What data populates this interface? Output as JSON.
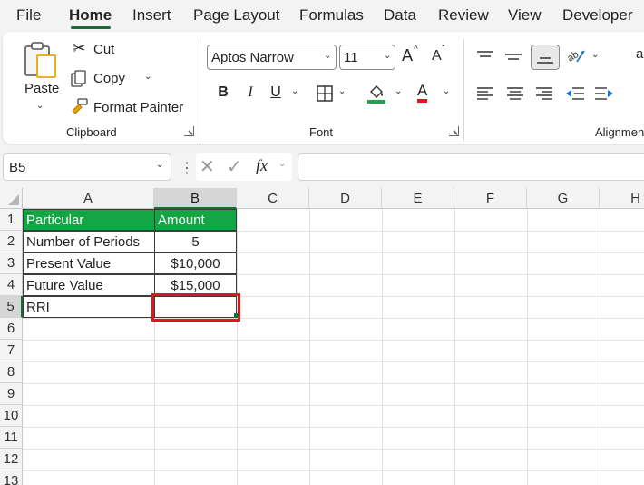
{
  "menu_tabs": [
    "File",
    "Home",
    "Insert",
    "Page Layout",
    "Formulas",
    "Data",
    "Review",
    "View",
    "Developer"
  ],
  "active_tab": "Home",
  "clipboard": {
    "paste": "Paste",
    "cut": "Cut",
    "copy": "Copy",
    "format_painter": "Format Painter",
    "group_label": "Clipboard"
  },
  "font": {
    "font_name": "Aptos Narrow",
    "font_size": "11",
    "group_label": "Font",
    "bold": "B",
    "italic": "I",
    "underline": "U",
    "font_color_letter": "A",
    "grow": "A",
    "shrink": "A",
    "fill_color": "#22a04b",
    "font_color": "#e0161b"
  },
  "alignment": {
    "group_label": "Alignment"
  },
  "formula_bar": {
    "name_box": "B5",
    "fx_label": "fx",
    "formula": ""
  },
  "sheet": {
    "columns": [
      "A",
      "B",
      "C",
      "D",
      "E",
      "F",
      "G",
      "H"
    ],
    "rows": [
      "1",
      "2",
      "3",
      "4",
      "5",
      "6",
      "7",
      "8",
      "9",
      "10",
      "11",
      "12",
      "13"
    ],
    "selected_cell": "B5",
    "header_fill": "#14a545",
    "table": {
      "header": [
        "Particular",
        "Amount"
      ],
      "rows": [
        [
          "Number of Periods",
          "5"
        ],
        [
          "Present Value",
          "$10,000"
        ],
        [
          "Future Value",
          "$15,000"
        ],
        [
          "RRI",
          ""
        ]
      ]
    }
  },
  "highlight_color": "#e0161b"
}
